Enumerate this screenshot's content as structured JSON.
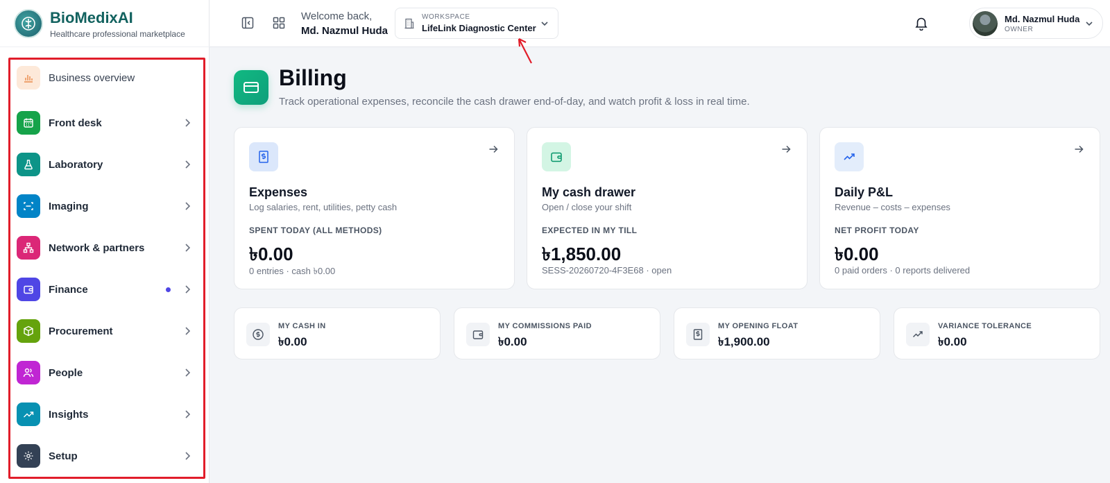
{
  "brand": {
    "name": "BioMedixAI",
    "tagline": "Healthcare professional marketplace"
  },
  "header": {
    "welcome": "Welcome back,",
    "user_display": "Md. Nazmul Huda",
    "workspace_label": "WORKSPACE",
    "workspace_value": "LifeLink Diagnostic Center",
    "user_name": "Md. Nazmul Huda",
    "user_role": "OWNER"
  },
  "sidebar": {
    "items": [
      {
        "label": "Business overview",
        "icon": "bar-chart-icon",
        "color": "#fde9d9"
      },
      {
        "label": "Front desk",
        "icon": "calendar-icon",
        "color": "#16a34a"
      },
      {
        "label": "Laboratory",
        "icon": "flask-icon",
        "color": "#0d9488"
      },
      {
        "label": "Imaging",
        "icon": "scan-icon",
        "color": "#0284c7"
      },
      {
        "label": "Network & partners",
        "icon": "network-icon",
        "color": "#db2777"
      },
      {
        "label": "Finance",
        "icon": "wallet-icon",
        "color": "#4f46e5"
      },
      {
        "label": "Procurement",
        "icon": "package-icon",
        "color": "#65a30d"
      },
      {
        "label": "People",
        "icon": "users-icon",
        "color": "#c026d3"
      },
      {
        "label": "Insights",
        "icon": "trending-icon",
        "color": "#0891b2"
      },
      {
        "label": "Setup",
        "icon": "gear-icon",
        "color": "#334155"
      }
    ]
  },
  "page": {
    "title": "Billing",
    "subtitle": "Track operational expenses, reconcile the cash drawer end-of-day, and watch profit & loss in real time."
  },
  "cards": [
    {
      "title": "Expenses",
      "desc": "Log salaries, rent, utilities, petty cash",
      "metric_label": "SPENT TODAY (ALL METHODS)",
      "metric_value": "৳0.00",
      "meta": "0 entries · cash ৳0.00"
    },
    {
      "title": "My cash drawer",
      "desc": "Open / close your shift",
      "metric_label": "EXPECTED IN MY TILL",
      "metric_value": "৳1,850.00",
      "meta": "SESS-20260720-4F3E68 · open"
    },
    {
      "title": "Daily P&L",
      "desc": "Revenue – costs – expenses",
      "metric_label": "NET PROFIT TODAY",
      "metric_value": "৳0.00",
      "meta": "0 paid orders · 0 reports delivered"
    }
  ],
  "stats": [
    {
      "label": "MY CASH IN",
      "value": "৳0.00"
    },
    {
      "label": "MY COMMISSIONS PAID",
      "value": "৳0.00"
    },
    {
      "label": "MY OPENING FLOAT",
      "value": "৳1,900.00"
    },
    {
      "label": "VARIANCE TOLERANCE",
      "value": "৳0.00"
    }
  ]
}
